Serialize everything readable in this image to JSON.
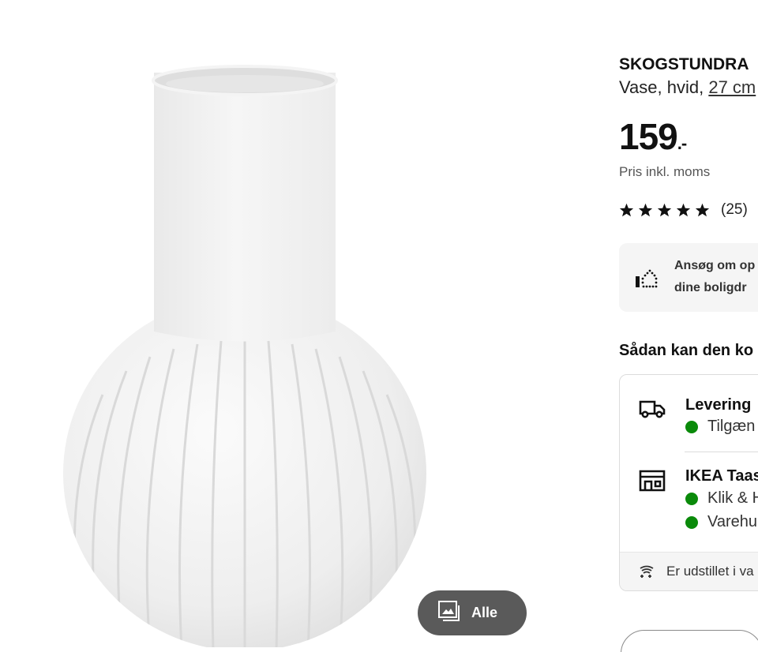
{
  "product": {
    "name": "SKOGSTUNDRA",
    "description": "Vase, hvid, ",
    "size_link": "27 cm",
    "price": "159",
    "price_suffix": ".-",
    "vat_note": "Pris inkl. moms",
    "rating": {
      "stars": 5,
      "max_stars": 5,
      "count": "(25)"
    }
  },
  "gallery": {
    "all_button_label": "Alle",
    "icon": "images-icon"
  },
  "promo": {
    "icon": "home-dots-icon",
    "line1": "Ansøg om op",
    "line2": "dine boligdr"
  },
  "availability": {
    "heading": "Sådan kan den ko",
    "delivery": {
      "icon": "truck-icon",
      "title": "Levering",
      "status": "Tilgæn",
      "status_color": "#0a8a0a"
    },
    "store": {
      "icon": "store-icon",
      "title": "IKEA Taas",
      "lines": [
        {
          "text": "Klik & H",
          "status_color": "#0a8a0a"
        },
        {
          "text": "Varehu",
          "status_color": "#0a8a0a"
        }
      ]
    },
    "footer": {
      "icon": "sparkle-hand-icon",
      "text": "Er udstillet i va"
    }
  },
  "colors": {
    "accent_green": "#0a8a0a",
    "button_dark": "#5a5a5a",
    "panel_bg": "#f5f5f5"
  }
}
